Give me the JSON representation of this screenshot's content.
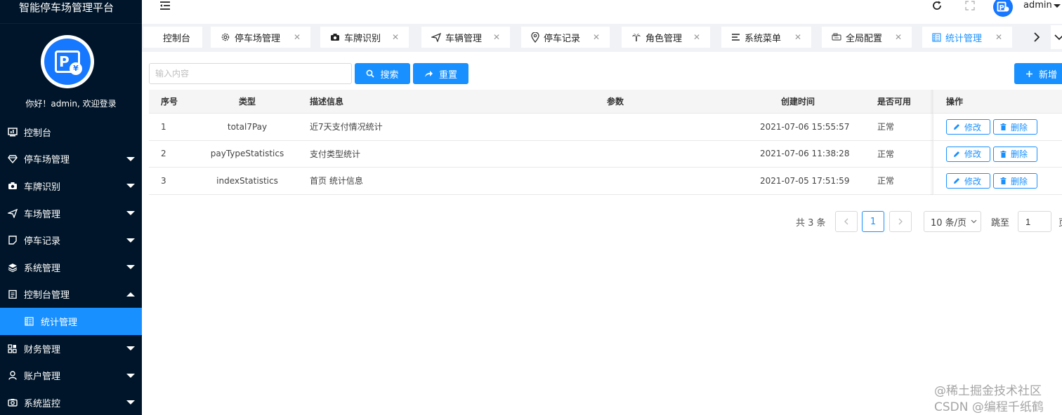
{
  "app": {
    "title": "智能停车场管理平台",
    "welcome": "你好！admin, 欢迎登录"
  },
  "sidebar": {
    "items": [
      {
        "label": "控制台",
        "icon": "dashboard-icon"
      },
      {
        "label": "停车场管理",
        "icon": "diamond-icon"
      },
      {
        "label": "车牌识别",
        "icon": "camera-icon"
      },
      {
        "label": "车场管理",
        "icon": "send-icon"
      },
      {
        "label": "停车记录",
        "icon": "note-icon"
      },
      {
        "label": "系统管理",
        "icon": "layers-icon"
      },
      {
        "label": "控制台管理",
        "icon": "clipboard-icon"
      },
      {
        "label": "统计管理",
        "icon": "stats-icon"
      },
      {
        "label": "财务管理",
        "icon": "grid-icon"
      },
      {
        "label": "账户管理",
        "icon": "user-icon"
      },
      {
        "label": "系统监控",
        "icon": "monitor-icon"
      }
    ]
  },
  "header": {
    "username": "admin"
  },
  "tabs": [
    {
      "label": "控制台"
    },
    {
      "label": "停车场管理",
      "icon": "gear-icon"
    },
    {
      "label": "车牌识别",
      "icon": "camera-icon"
    },
    {
      "label": "车辆管理",
      "icon": "send-icon"
    },
    {
      "label": "停车记录",
      "icon": "location-icon"
    },
    {
      "label": "角色管理",
      "icon": "palm-icon"
    },
    {
      "label": "系统菜单",
      "icon": "menu-icon"
    },
    {
      "label": "全局配置",
      "icon": "config-icon"
    },
    {
      "label": "统计管理",
      "icon": "stats-icon"
    }
  ],
  "toolbar": {
    "search_placeholder": "输入内容",
    "search_label": "搜索",
    "reset_label": "重置",
    "add_label": "新增"
  },
  "table": {
    "headers": [
      "序号",
      "类型",
      "描述信息",
      "参数",
      "创建时间",
      "是否可用",
      "操作"
    ],
    "rows": [
      {
        "index": "1",
        "type": "total7Pay",
        "desc": "近7天支付情况统计",
        "param": "",
        "created": "2021-07-06 15:55:57",
        "status": "正常"
      },
      {
        "index": "2",
        "type": "payTypeStatistics",
        "desc": "支付类型统计",
        "param": "",
        "created": "2021-07-06 11:38:28",
        "status": "正常"
      },
      {
        "index": "3",
        "type": "indexStatistics",
        "desc": "首页 统计信息",
        "param": "",
        "created": "2021-07-05 17:51:59",
        "status": "正常"
      }
    ],
    "edit_label": "修改",
    "delete_label": "删除"
  },
  "pagination": {
    "total": "共 3 条",
    "current": "1",
    "page_size": "10 条/页",
    "goto_label": "跳至",
    "goto_value": "1",
    "goto_suffix": "页"
  },
  "watermark": {
    "line1": "@稀土掘金技术社区",
    "line2": "CSDN @编程千纸鹤"
  },
  "colors": {
    "sidebar_bg": "#001529",
    "primary": "#1890ff",
    "tabs_bg": "#f0f2f5"
  }
}
